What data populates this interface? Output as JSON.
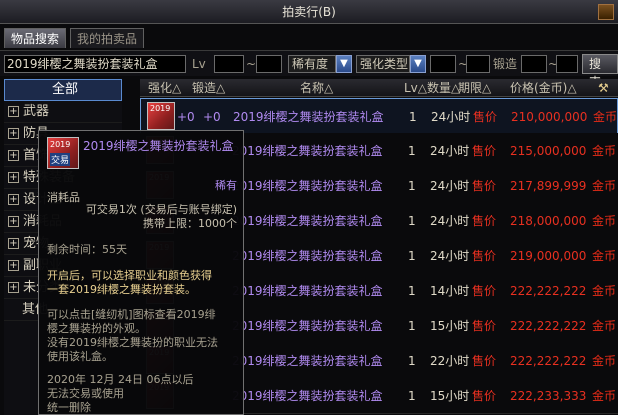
{
  "window": {
    "title": "拍卖行(B)"
  },
  "tabs": [
    {
      "label": "物品搜索"
    },
    {
      "label": "我的拍卖品"
    }
  ],
  "filters": {
    "search_value": "2019绯樱之舞装扮套装礼盒",
    "lv_label": "Lv",
    "lv_sep": "~",
    "rarity_label": "稀有度",
    "enhance_label": "强化类型",
    "forge_label": "锻造",
    "search_button": "搜索"
  },
  "sidebar": {
    "items": [
      {
        "label": "全部",
        "selected": true
      },
      {
        "label": "武器"
      },
      {
        "label": "防具"
      },
      {
        "label": "首饰"
      },
      {
        "label": "特殊装备"
      },
      {
        "label": "设计图"
      },
      {
        "label": "消耗品"
      },
      {
        "label": "宠物"
      },
      {
        "label": "副职业"
      },
      {
        "label": "未分类"
      },
      {
        "label": "其他"
      }
    ]
  },
  "columns": {
    "enhance": "强化△",
    "forge": "锻造△",
    "name": "名称△",
    "level_qty": "Lv△数量△",
    "deadline": "期限△",
    "price": "价格(金币)△"
  },
  "rows": [
    {
      "enhance": "+0",
      "forge": "+0",
      "name": "2019绯樱之舞装扮套装礼盒",
      "qty": "1",
      "time": "24小时",
      "tag": "售价",
      "price": "210,000,000",
      "currency": "金币"
    },
    {
      "enhance": "",
      "forge": "",
      "name": "2019绯樱之舞装扮套装礼盒",
      "qty": "1",
      "time": "24小时",
      "tag": "售价",
      "price": "215,000,000",
      "currency": "金币"
    },
    {
      "enhance": "",
      "forge": "",
      "name": "2019绯樱之舞装扮套装礼盒",
      "qty": "1",
      "time": "24小时",
      "tag": "售价",
      "price": "217,899,999",
      "currency": "金币"
    },
    {
      "enhance": "",
      "forge": "",
      "name": "2019绯樱之舞装扮套装礼盒",
      "qty": "1",
      "time": "24小时",
      "tag": "售价",
      "price": "218,000,000",
      "currency": "金币"
    },
    {
      "enhance": "",
      "forge": "",
      "name": "2019绯樱之舞装扮套装礼盒",
      "qty": "1",
      "time": "24小时",
      "tag": "售价",
      "price": "219,000,000",
      "currency": "金币"
    },
    {
      "enhance": "",
      "forge": "",
      "name": "2019绯樱之舞装扮套装礼盒",
      "qty": "1",
      "time": "14小时",
      "tag": "售价",
      "price": "222,222,222",
      "currency": "金币"
    },
    {
      "enhance": "",
      "forge": "",
      "name": "2019绯樱之舞装扮套装礼盒",
      "qty": "1",
      "time": "15小时",
      "tag": "售价",
      "price": "222,222,222",
      "currency": "金币"
    },
    {
      "enhance": "",
      "forge": "",
      "name": "2019绯樱之舞装扮套装礼盒",
      "qty": "1",
      "time": "22小时",
      "tag": "售价",
      "price": "222,222,222",
      "currency": "金币"
    },
    {
      "enhance": "",
      "forge": "",
      "name": "2019绯樱之舞装扮套装礼盒",
      "qty": "1",
      "time": "15小时",
      "tag": "售价",
      "price": "222,233,333",
      "currency": "金币"
    }
  ],
  "tooltip": {
    "icon_year": "2019",
    "icon_trade": "交易",
    "title": "2019绯樱之舞装扮套装礼盒",
    "rarity": "稀有",
    "type": "消耗品",
    "trade_info": "可交易1次 (交易后与账号绑定)",
    "carry_limit": "携带上限：1000个",
    "remaining": "剩余时间：55天",
    "desc1a": "开启后，可以选择职业和颜色获得",
    "desc1b": "一套2019绯樱之舞装扮套装。",
    "desc2a": "可以点击[缝纫机]图标查看2019绯",
    "desc2b": "樱之舞装扮的外观。",
    "desc3a": "没有2019绯樱之舞装扮的职业无法",
    "desc3b": "使用该礼盒。",
    "exp1": "2020年 12月 24日 06点以后",
    "exp2": "无法交易或使用",
    "exp3": "统一删除"
  },
  "colors": {
    "name": "#b08af0",
    "price": "#e83020",
    "selection": "#6a9ad8"
  }
}
